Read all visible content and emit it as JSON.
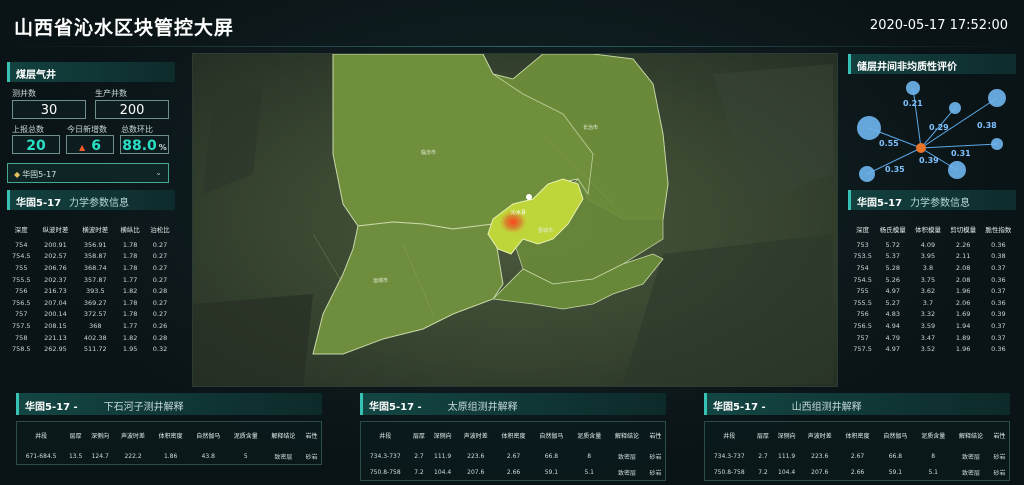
{
  "header": {
    "title": "山西省沁水区块管控大屏",
    "datetime": "2020-05-17 17:52:00"
  },
  "left_top": {
    "title": "煤层气井",
    "test_wells_label": "测井数",
    "test_wells": "30",
    "prod_wells_label": "生产井数",
    "prod_wells": "200",
    "reported_label": "上报总数",
    "reported": "20",
    "new_today_label": "今日新增数",
    "new_today": "6",
    "ratio_label": "总数环比",
    "ratio": "88.0",
    "ratio_unit": "%",
    "select_value": "华固5-17",
    "colors": {
      "accent": "#29e0c6",
      "up_arrow": "#ff5a2a"
    }
  },
  "left_table": {
    "title": "华固5-17",
    "subtitle": "力学参数信息",
    "headers": [
      "深度",
      "纵波时差",
      "横波时差",
      "横纵比",
      "泊松比"
    ],
    "rows": [
      [
        "754",
        "200.91",
        "356.91",
        "1.78",
        "0.27"
      ],
      [
        "754.5",
        "202.57",
        "358.87",
        "1.78",
        "0.27"
      ],
      [
        "755",
        "206.76",
        "368.74",
        "1.78",
        "0.27"
      ],
      [
        "755.5",
        "202.37",
        "357.87",
        "1.77",
        "0.27"
      ],
      [
        "756",
        "216.73",
        "393.5",
        "1.82",
        "0.28"
      ],
      [
        "756.5",
        "207.04",
        "369.27",
        "1.78",
        "0.27"
      ],
      [
        "757",
        "200.14",
        "372.57",
        "1.78",
        "0.27"
      ],
      [
        "757.5",
        "208.15",
        "368",
        "1.77",
        "0.26"
      ],
      [
        "758",
        "221.13",
        "402.38",
        "1.82",
        "0.28"
      ],
      [
        "758.5",
        "262.95",
        "511.72",
        "1.95",
        "0.32"
      ]
    ]
  },
  "map": {
    "labels": [
      "晋城市",
      "长治市",
      "临汾市",
      "运城市",
      "沁水县"
    ]
  },
  "right_chart": {
    "title": "储层井间非均质性评价",
    "chart_data": {
      "type": "scatter",
      "title": "储层井间非均质性评价",
      "points": [
        0.21,
        0.29,
        0.38,
        0.55,
        0.31,
        0.39,
        0.35
      ]
    }
  },
  "right_table": {
    "title": "华固5-17",
    "subtitle": "力学参数信息",
    "headers": [
      "深度",
      "杨氏模量",
      "体积模量",
      "剪切模量",
      "脆性指数"
    ],
    "rows": [
      [
        "753",
        "5.72",
        "4.09",
        "2.26",
        "0.36"
      ],
      [
        "753.5",
        "5.37",
        "3.95",
        "2.11",
        "0.38"
      ],
      [
        "754",
        "5.28",
        "3.8",
        "2.08",
        "0.37"
      ],
      [
        "754.5",
        "5.26",
        "3.75",
        "2.08",
        "0.36"
      ],
      [
        "755",
        "4.97",
        "3.62",
        "1.96",
        "0.37"
      ],
      [
        "755.5",
        "5.27",
        "3.7",
        "2.06",
        "0.36"
      ],
      [
        "756",
        "4.83",
        "3.32",
        "1.69",
        "0.39"
      ],
      [
        "756.5",
        "4.94",
        "3.59",
        "1.94",
        "0.37"
      ],
      [
        "757",
        "4.79",
        "3.47",
        "1.89",
        "0.37"
      ],
      [
        "757.5",
        "4.97",
        "3.52",
        "1.96",
        "0.36"
      ]
    ]
  },
  "bottom": {
    "headers": [
      "井段",
      "层厚",
      "深侧向",
      "声波时差",
      "体积密度",
      "自然伽马",
      "泥质含量",
      "解释结论",
      "岩性"
    ],
    "panels": [
      {
        "title": "华固5-17 -",
        "subtitle": "下石河子测井解释",
        "rows": [
          [
            "671-684.5",
            "13.5",
            "124.7",
            "222.2",
            "1.86",
            "43.8",
            "5",
            "致密层",
            "砂岩"
          ]
        ]
      },
      {
        "title": "华固5-17 -",
        "subtitle": "太原组测井解释",
        "rows": [
          [
            "734.3-737",
            "2.7",
            "111.9",
            "223.6",
            "2.67",
            "66.8",
            "8",
            "致密层",
            "砂岩"
          ],
          [
            "750.8-758",
            "7.2",
            "104.4",
            "207.6",
            "2.66",
            "59.1",
            "5.1",
            "致密层",
            "砂岩"
          ]
        ]
      },
      {
        "title": "华固5-17 -",
        "subtitle": "山西组测井解释",
        "rows": [
          [
            "734.3-737",
            "2.7",
            "111.9",
            "223.6",
            "2.67",
            "66.8",
            "8",
            "致密层",
            "砂岩"
          ],
          [
            "750.8-758",
            "7.2",
            "104.4",
            "207.6",
            "2.66",
            "59.1",
            "5.1",
            "致密层",
            "砂岩"
          ]
        ]
      }
    ]
  }
}
